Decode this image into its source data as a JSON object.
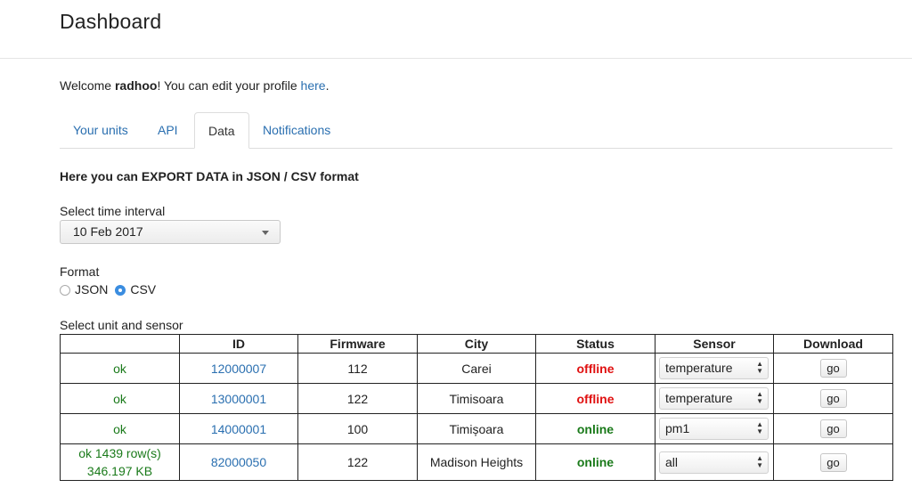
{
  "header": {
    "title": "Dashboard"
  },
  "welcome": {
    "prefix": "Welcome ",
    "username": "radhoo",
    "middle": "! You can edit your profile ",
    "link": "here",
    "suffix": "."
  },
  "tabs": [
    {
      "label": "Your units",
      "active": false
    },
    {
      "label": "API",
      "active": false
    },
    {
      "label": "Data",
      "active": true
    },
    {
      "label": "Notifications",
      "active": false
    }
  ],
  "export": {
    "title": "Here you can EXPORT DATA in JSON / CSV format",
    "interval_label": "Select time interval",
    "interval_value": "10 Feb 2017",
    "format_label": "Format",
    "format_options": [
      "JSON",
      "CSV"
    ],
    "format_selected": "CSV",
    "unit_label": "Select unit and sensor"
  },
  "table": {
    "headers": [
      "",
      "ID",
      "Firmware",
      "City",
      "Status",
      "Sensor",
      "Download"
    ],
    "rows": [
      {
        "result": "ok",
        "result2": "",
        "id": "12000007",
        "firmware": "112",
        "city": "Carei",
        "status": "offline",
        "sensor": "temperature",
        "download": "go"
      },
      {
        "result": "ok",
        "result2": "",
        "id": "13000001",
        "firmware": "122",
        "city": "Timisoara",
        "status": "offline",
        "sensor": "temperature",
        "download": "go"
      },
      {
        "result": "ok",
        "result2": "",
        "id": "14000001",
        "firmware": "100",
        "city": "Timișoara",
        "status": "online",
        "sensor": "pm1",
        "download": "go"
      },
      {
        "result": "ok 1439 row(s)",
        "result2": "346.197 KB",
        "id": "82000050",
        "firmware": "122",
        "city": "Madison Heights",
        "status": "online",
        "sensor": "all",
        "download": "go"
      }
    ]
  },
  "colors": {
    "link": "#2a6fb0",
    "ok": "#1a7a1a",
    "offline": "#e01010",
    "online": "#1a7a1a",
    "radio_checked": "#3b8de0"
  },
  "icons": {
    "select_caret": "caret-down-icon",
    "sensor_arrows": "updown-arrows-icon"
  }
}
